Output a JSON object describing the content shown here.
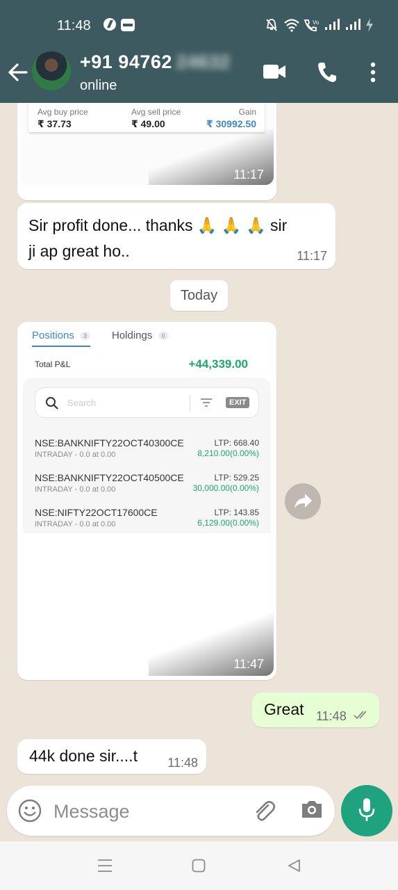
{
  "status_bar": {
    "time": "11:48",
    "signal_text": "Vo LTE"
  },
  "header": {
    "contact_number": "+91 94762",
    "contact_number_hidden": "24632",
    "status": "online"
  },
  "messages": {
    "first_image": {
      "labels": [
        "Avg buy price",
        "Avg sell price",
        "Gain"
      ],
      "values": [
        "₹ 37.73",
        "₹ 49.00",
        "₹ 30992.50"
      ],
      "time": "11:17"
    },
    "msg1": {
      "text_line1": "Sir profit done... thanks 🙏 🙏 🙏 sir",
      "text_line2": "ji ap great ho..",
      "time": "11:17"
    },
    "date_chip": "Today",
    "positions_image": {
      "tab_positions": "Positions",
      "tab_positions_count": "3",
      "tab_holdings": "Holdings",
      "tab_holdings_count": "0",
      "total_label": "Total P&L",
      "total_value": "+44,339.00",
      "search_placeholder": "Search",
      "exit_label": "EXIT",
      "rows": [
        {
          "symbol": "NSE:BANKNIFTY22OCT40300CE",
          "detail": "INTRADAY -  0.0 at 0.00",
          "ltp": "LTP: 668.40",
          "pnl": "8,210.00(0.00%)"
        },
        {
          "symbol": "NSE:BANKNIFTY22OCT40500CE",
          "detail": "INTRADAY -  0.0 at 0.00",
          "ltp": "LTP: 529.25",
          "pnl": "30,000.00(0.00%)"
        },
        {
          "symbol": "NSE:NIFTY22OCT17600CE",
          "detail": "INTRADAY -  0.0 at 0.00",
          "ltp": "LTP: 143.85",
          "pnl": "6,129.00(0.00%)"
        }
      ],
      "time": "11:47"
    },
    "msg_out": {
      "text": "Great",
      "time": "11:48"
    },
    "msg_last": {
      "text": "44k done sir....t",
      "time": "11:48"
    }
  },
  "input": {
    "placeholder": "Message"
  },
  "colors": {
    "header": "#3c5a5f",
    "chat_bg": "#ede4d9",
    "accent": "#1fa37e",
    "profit": "#1ba672",
    "link_blue": "#3e86c9"
  }
}
